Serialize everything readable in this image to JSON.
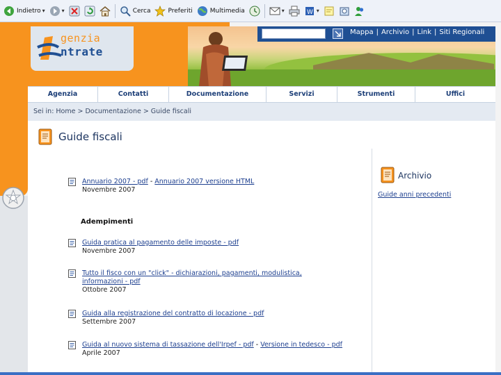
{
  "browser_toolbar": {
    "indietro": "Indietro",
    "cerca": "Cerca",
    "preferiti": "Preferiti",
    "multimedia": "Multimedia"
  },
  "site": {
    "logo_line1": "genzia",
    "logo_line2": "ntrate",
    "search": {
      "placeholder": ""
    },
    "top_links": [
      "Mappa",
      "Archivio",
      "Link",
      "Siti Regionali"
    ],
    "nav": [
      "Agenzia",
      "Contatti",
      "Documentazione",
      "Servizi",
      "Strumenti",
      "Uffici"
    ],
    "breadcrumb": "Sei in: Home  >  Documentazione  >  Guide fiscali"
  },
  "page": {
    "title": "Guide fiscali",
    "documents": [
      {
        "link1": "Annuario 2007 - pdf",
        "sep": " - ",
        "link2": "Annuario 2007 versione HTML",
        "date": "Novembre 2007"
      }
    ],
    "section": "Adempimenti",
    "adempimenti": [
      {
        "link": "Guida pratica al pagamento delle imposte - pdf",
        "date": "Novembre 2007"
      },
      {
        "link": "Tutto il fisco con un \"click\" - dichiarazioni, pagamenti, modulistica, informazioni - pdf",
        "date": "Ottobre 2007"
      },
      {
        "link": "Guida alla registrazione del contratto di locazione - pdf",
        "date": "Settembre 2007"
      },
      {
        "link1": "Guida al nuovo sistema di tassazione dell'Irpef - pdf",
        "sep": " - ",
        "link2": "Versione in tedesco - pdf",
        "date": "Aprile 2007"
      }
    ],
    "archive": {
      "title": "Archivio",
      "link": "Guide anni precedenti"
    }
  },
  "colors": {
    "orange": "#f7931e",
    "navy": "#1d3f78",
    "link": "#1d3f8f"
  }
}
